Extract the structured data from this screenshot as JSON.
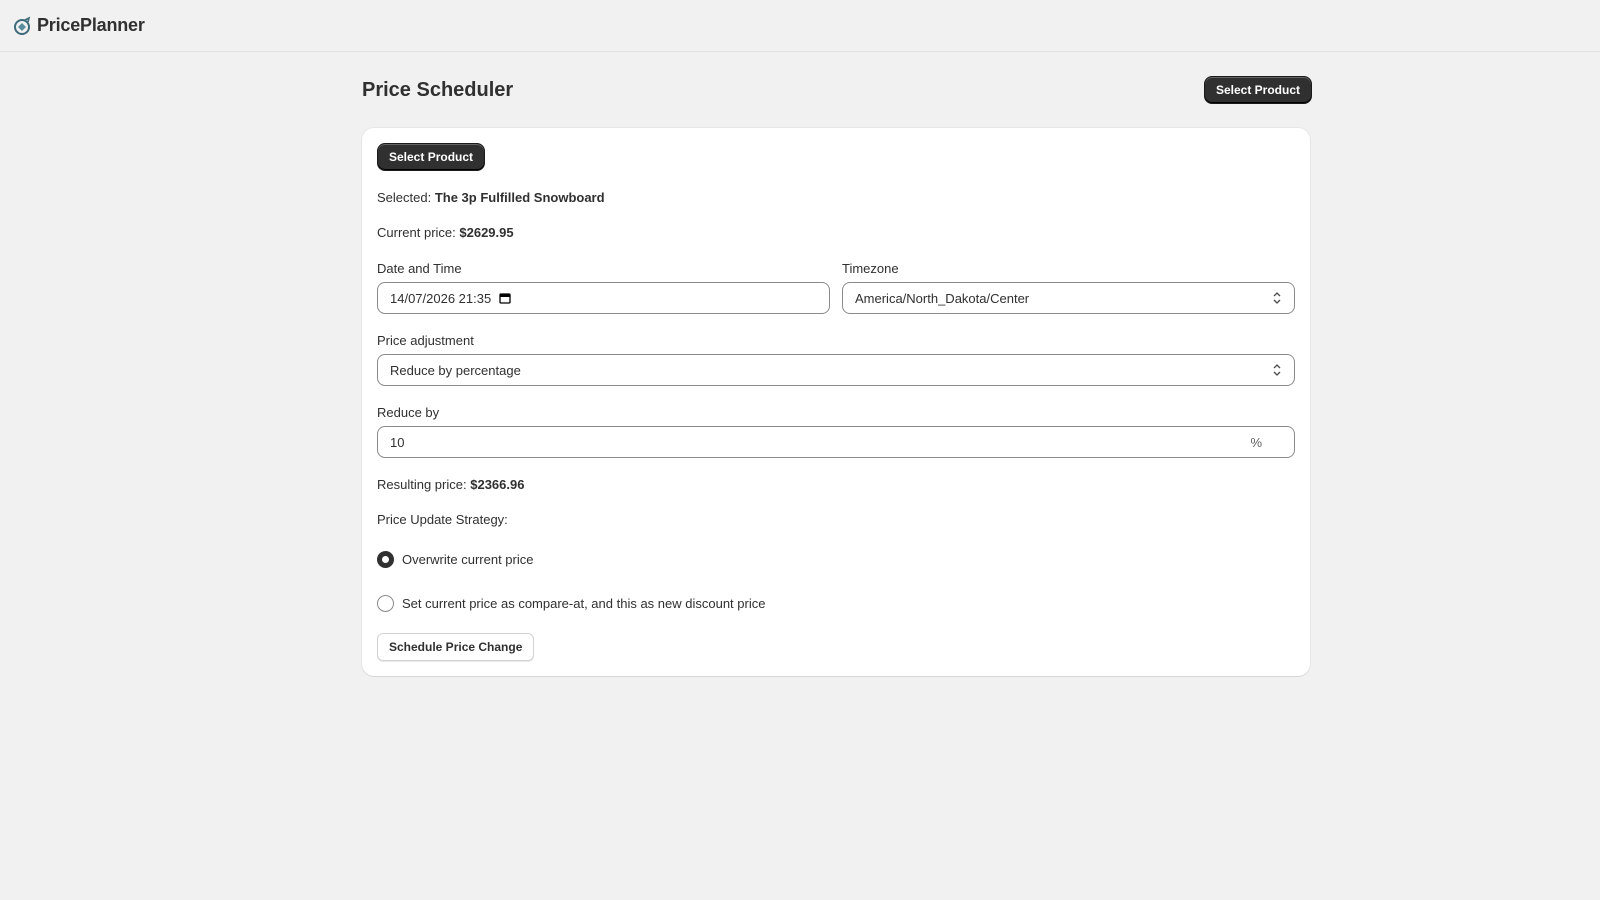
{
  "app": {
    "title": "PricePlanner"
  },
  "header": {
    "title": "Price Scheduler",
    "select_product_label": "Select Product"
  },
  "card": {
    "select_product_label": "Select Product",
    "selected_label": "Selected:",
    "selected_product": "The 3p Fulfilled Snowboard",
    "current_price_label": "Current price:",
    "current_price": "$2629.95",
    "datetime": {
      "label": "Date and Time",
      "value": "14/07/2026 21:35"
    },
    "timezone": {
      "label": "Timezone",
      "value": "America/North_Dakota/Center"
    },
    "adjustment": {
      "label": "Price adjustment",
      "value": "Reduce by percentage"
    },
    "reduce_by": {
      "label": "Reduce by",
      "value": "10",
      "suffix": "%"
    },
    "resulting_price_label": "Resulting price:",
    "resulting_price": "$2366.96",
    "strategy_label": "Price Update Strategy:",
    "strategies": [
      {
        "label": "Overwrite current price",
        "checked": true
      },
      {
        "label": "Set current price as compare-at, and this as new discount price",
        "checked": false
      }
    ],
    "schedule_button_label": "Schedule Price Change"
  },
  "colors": {
    "primary_button": "#303030",
    "background": "#f1f1f1",
    "logo": "#3d6b7a"
  }
}
